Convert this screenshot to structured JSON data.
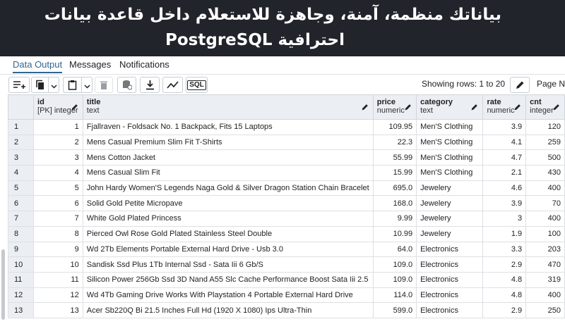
{
  "banner": {
    "line1": "بياناتك منظمة، آمنة، وجاهزة للاستعلام داخل قاعدة بيانات",
    "line2": "احترافية PostgreSQL"
  },
  "tabs": [
    {
      "label": "Data Output",
      "active": true
    },
    {
      "label": "Messages",
      "active": false
    },
    {
      "label": "Notifications",
      "active": false
    }
  ],
  "toolbar": {
    "showing_rows": "Showing rows: 1 to 20",
    "page_label": "Page N",
    "sql_label": "SQL",
    "icons": [
      "add-row-icon",
      "copy-icon",
      "paste-icon",
      "delete-icon",
      "save-data-icon",
      "download-icon",
      "graph-icon",
      "sql-icon"
    ]
  },
  "columns": [
    {
      "name": "id",
      "type": "[PK] integer"
    },
    {
      "name": "title",
      "type": "text"
    },
    {
      "name": "price",
      "type": "numeric"
    },
    {
      "name": "category",
      "type": "text"
    },
    {
      "name": "rate",
      "type": "numeric"
    },
    {
      "name": "cnt",
      "type": "integer"
    }
  ],
  "rows": [
    {
      "n": "1",
      "id": "1",
      "title": "Fjallraven - Foldsack No. 1 Backpack, Fits 15 Laptops",
      "price": "109.95",
      "category": "Men'S Clothing",
      "rate": "3.9",
      "cnt": "120"
    },
    {
      "n": "2",
      "id": "2",
      "title": "Mens Casual Premium Slim Fit T-Shirts",
      "price": "22.3",
      "category": "Men'S Clothing",
      "rate": "4.1",
      "cnt": "259"
    },
    {
      "n": "3",
      "id": "3",
      "title": "Mens Cotton Jacket",
      "price": "55.99",
      "category": "Men'S Clothing",
      "rate": "4.7",
      "cnt": "500"
    },
    {
      "n": "4",
      "id": "4",
      "title": "Mens Casual Slim Fit",
      "price": "15.99",
      "category": "Men'S Clothing",
      "rate": "2.1",
      "cnt": "430"
    },
    {
      "n": "5",
      "id": "5",
      "title": "John Hardy Women'S Legends Naga Gold & Silver Dragon Station Chain Bracelet",
      "price": "695.0",
      "category": "Jewelery",
      "rate": "4.6",
      "cnt": "400"
    },
    {
      "n": "6",
      "id": "6",
      "title": "Solid Gold Petite Micropave",
      "price": "168.0",
      "category": "Jewelery",
      "rate": "3.9",
      "cnt": "70"
    },
    {
      "n": "7",
      "id": "7",
      "title": "White Gold Plated Princess",
      "price": "9.99",
      "category": "Jewelery",
      "rate": "3",
      "cnt": "400"
    },
    {
      "n": "8",
      "id": "8",
      "title": "Pierced Owl Rose Gold Plated Stainless Steel Double",
      "price": "10.99",
      "category": "Jewelery",
      "rate": "1.9",
      "cnt": "100"
    },
    {
      "n": "9",
      "id": "9",
      "title": "Wd 2Tb Elements Portable External Hard Drive - Usb 3.0",
      "price": "64.0",
      "category": "Electronics",
      "rate": "3.3",
      "cnt": "203"
    },
    {
      "n": "10",
      "id": "10",
      "title": "Sandisk Ssd Plus 1Tb Internal Ssd - Sata Iii 6 Gb/S",
      "price": "109.0",
      "category": "Electronics",
      "rate": "2.9",
      "cnt": "470"
    },
    {
      "n": "11",
      "id": "11",
      "title": "Silicon Power 256Gb Ssd 3D Nand A55 Slc Cache Performance Boost Sata Iii 2.5",
      "price": "109.0",
      "category": "Electronics",
      "rate": "4.8",
      "cnt": "319"
    },
    {
      "n": "12",
      "id": "12",
      "title": "Wd 4Tb Gaming Drive Works With Playstation 4 Portable External Hard Drive",
      "price": "114.0",
      "category": "Electronics",
      "rate": "4.8",
      "cnt": "400"
    },
    {
      "n": "13",
      "id": "13",
      "title": "Acer Sb220Q Bi 21.5 Inches Full Hd (1920 X 1080) Ips Ultra-Thin",
      "price": "599.0",
      "category": "Electronics",
      "rate": "2.9",
      "cnt": "250"
    }
  ]
}
